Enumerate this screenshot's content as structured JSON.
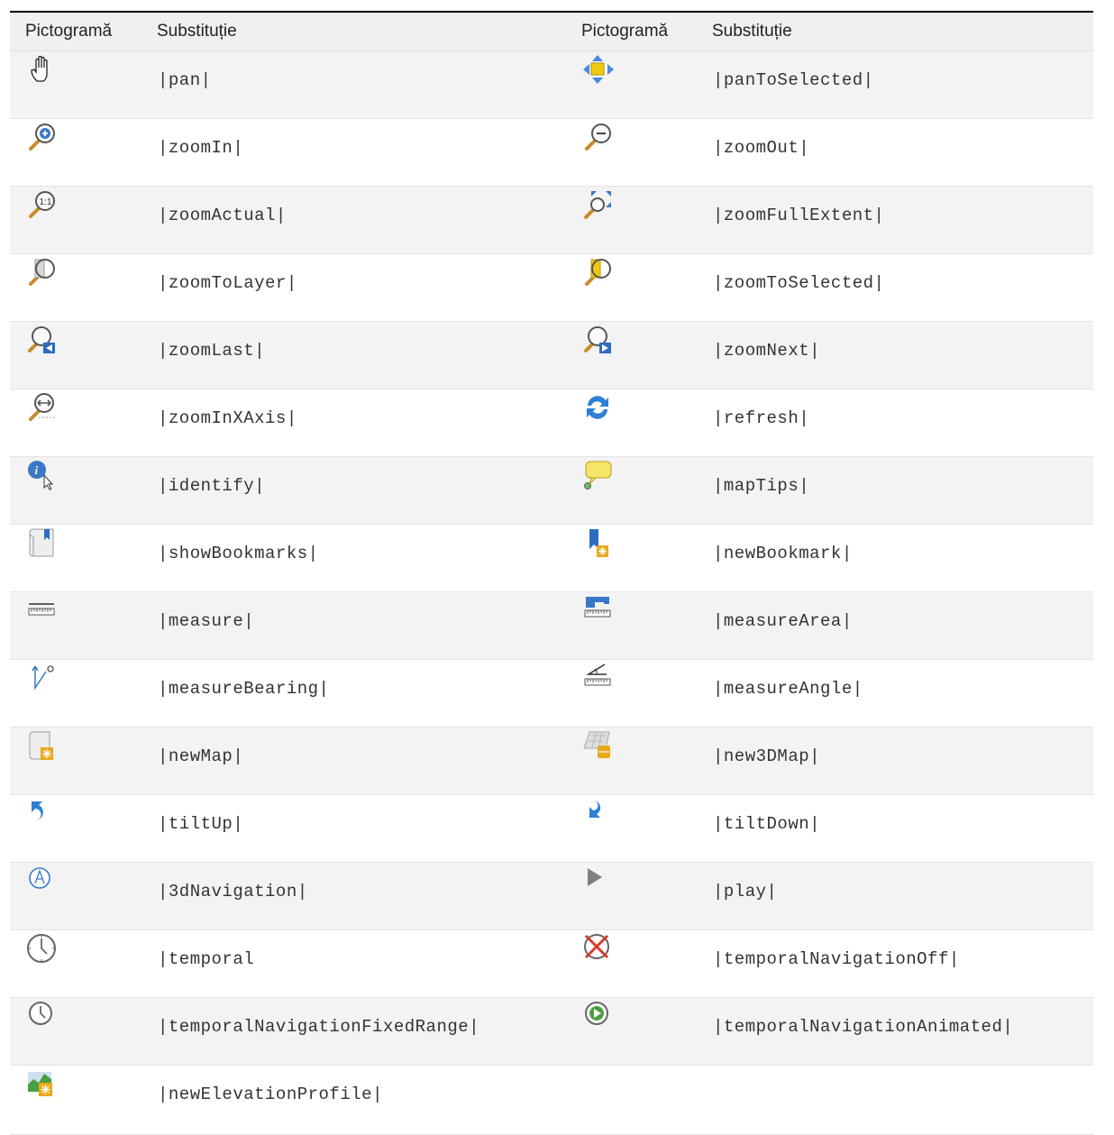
{
  "header": {
    "col1": "Pictogramă",
    "col2": "Substituție",
    "col3": "Pictogramă",
    "col4": "Substituție"
  },
  "rows": [
    {
      "left": {
        "icon": "pan-hand-icon",
        "code": "|pan|"
      },
      "right": {
        "icon": "pan-to-selected-icon",
        "code": "|panToSelected|"
      }
    },
    {
      "left": {
        "icon": "zoom-in-icon",
        "code": "|zoomIn|"
      },
      "right": {
        "icon": "zoom-out-icon",
        "code": "|zoomOut|"
      }
    },
    {
      "left": {
        "icon": "zoom-actual-icon",
        "code": "|zoomActual|"
      },
      "right": {
        "icon": "zoom-full-extent-icon",
        "code": "|zoomFullExtent|"
      }
    },
    {
      "left": {
        "icon": "zoom-to-layer-icon",
        "code": "|zoomToLayer|"
      },
      "right": {
        "icon": "zoom-to-selected-icon",
        "code": "|zoomToSelected|"
      }
    },
    {
      "left": {
        "icon": "zoom-last-icon",
        "code": "|zoomLast|"
      },
      "right": {
        "icon": "zoom-next-icon",
        "code": "|zoomNext|"
      }
    },
    {
      "left": {
        "icon": "zoom-in-x-axis-icon",
        "code": "|zoomInXAxis|"
      },
      "right": {
        "icon": "refresh-icon",
        "code": "|refresh|"
      }
    },
    {
      "left": {
        "icon": "identify-icon",
        "code": "|identify|"
      },
      "right": {
        "icon": "map-tips-icon",
        "code": "|mapTips|"
      }
    },
    {
      "left": {
        "icon": "show-bookmarks-icon",
        "code": "|showBookmarks|"
      },
      "right": {
        "icon": "new-bookmark-icon",
        "code": "|newBookmark|"
      }
    },
    {
      "left": {
        "icon": "measure-icon",
        "code": "|measure|"
      },
      "right": {
        "icon": "measure-area-icon",
        "code": "|measureArea|"
      }
    },
    {
      "left": {
        "icon": "measure-bearing-icon",
        "code": "|measureBearing|"
      },
      "right": {
        "icon": "measure-angle-icon",
        "code": "|measureAngle|"
      }
    },
    {
      "left": {
        "icon": "new-map-icon",
        "code": "|newMap|"
      },
      "right": {
        "icon": "new-3d-map-icon",
        "code": "|new3DMap|"
      }
    },
    {
      "left": {
        "icon": "tilt-up-icon",
        "code": "|tiltUp|"
      },
      "right": {
        "icon": "tilt-down-icon",
        "code": "|tiltDown|"
      }
    },
    {
      "left": {
        "icon": "3d-navigation-icon",
        "code": "|3dNavigation|"
      },
      "right": {
        "icon": "play-icon",
        "code": "|play|"
      }
    },
    {
      "left": {
        "icon": "temporal-clock-icon",
        "code": "|temporal"
      },
      "right": {
        "icon": "temporal-navigation-off-icon",
        "code": "|temporalNavigationOff|"
      }
    },
    {
      "left": {
        "icon": "temporal-fixed-range-icon",
        "code": "|temporalNavigationFixedRange|"
      },
      "right": {
        "icon": "temporal-animated-icon",
        "code": "|temporalNavigationAnimated|"
      }
    },
    {
      "left": {
        "icon": "new-elevation-profile-icon",
        "code": "|newElevationProfile|"
      },
      "right": {
        "icon": "",
        "code": ""
      }
    }
  ]
}
